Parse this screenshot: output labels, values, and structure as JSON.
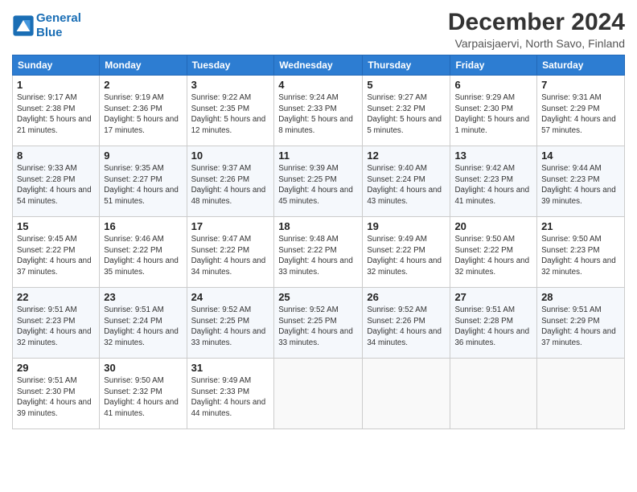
{
  "logo": {
    "line1": "General",
    "line2": "Blue"
  },
  "title": "December 2024",
  "subtitle": "Varpaisjaervi, North Savo, Finland",
  "days_of_week": [
    "Sunday",
    "Monday",
    "Tuesday",
    "Wednesday",
    "Thursday",
    "Friday",
    "Saturday"
  ],
  "weeks": [
    [
      {
        "day": "1",
        "sunrise": "9:17 AM",
        "sunset": "2:38 PM",
        "daylight": "5 hours and 21 minutes."
      },
      {
        "day": "2",
        "sunrise": "9:19 AM",
        "sunset": "2:36 PM",
        "daylight": "5 hours and 17 minutes."
      },
      {
        "day": "3",
        "sunrise": "9:22 AM",
        "sunset": "2:35 PM",
        "daylight": "5 hours and 12 minutes."
      },
      {
        "day": "4",
        "sunrise": "9:24 AM",
        "sunset": "2:33 PM",
        "daylight": "5 hours and 8 minutes."
      },
      {
        "day": "5",
        "sunrise": "9:27 AM",
        "sunset": "2:32 PM",
        "daylight": "5 hours and 5 minutes."
      },
      {
        "day": "6",
        "sunrise": "9:29 AM",
        "sunset": "2:30 PM",
        "daylight": "5 hours and 1 minute."
      },
      {
        "day": "7",
        "sunrise": "9:31 AM",
        "sunset": "2:29 PM",
        "daylight": "4 hours and 57 minutes."
      }
    ],
    [
      {
        "day": "8",
        "sunrise": "9:33 AM",
        "sunset": "2:28 PM",
        "daylight": "4 hours and 54 minutes."
      },
      {
        "day": "9",
        "sunrise": "9:35 AM",
        "sunset": "2:27 PM",
        "daylight": "4 hours and 51 minutes."
      },
      {
        "day": "10",
        "sunrise": "9:37 AM",
        "sunset": "2:26 PM",
        "daylight": "4 hours and 48 minutes."
      },
      {
        "day": "11",
        "sunrise": "9:39 AM",
        "sunset": "2:25 PM",
        "daylight": "4 hours and 45 minutes."
      },
      {
        "day": "12",
        "sunrise": "9:40 AM",
        "sunset": "2:24 PM",
        "daylight": "4 hours and 43 minutes."
      },
      {
        "day": "13",
        "sunrise": "9:42 AM",
        "sunset": "2:23 PM",
        "daylight": "4 hours and 41 minutes."
      },
      {
        "day": "14",
        "sunrise": "9:44 AM",
        "sunset": "2:23 PM",
        "daylight": "4 hours and 39 minutes."
      }
    ],
    [
      {
        "day": "15",
        "sunrise": "9:45 AM",
        "sunset": "2:22 PM",
        "daylight": "4 hours and 37 minutes."
      },
      {
        "day": "16",
        "sunrise": "9:46 AM",
        "sunset": "2:22 PM",
        "daylight": "4 hours and 35 minutes."
      },
      {
        "day": "17",
        "sunrise": "9:47 AM",
        "sunset": "2:22 PM",
        "daylight": "4 hours and 34 minutes."
      },
      {
        "day": "18",
        "sunrise": "9:48 AM",
        "sunset": "2:22 PM",
        "daylight": "4 hours and 33 minutes."
      },
      {
        "day": "19",
        "sunrise": "9:49 AM",
        "sunset": "2:22 PM",
        "daylight": "4 hours and 32 minutes."
      },
      {
        "day": "20",
        "sunrise": "9:50 AM",
        "sunset": "2:22 PM",
        "daylight": "4 hours and 32 minutes."
      },
      {
        "day": "21",
        "sunrise": "9:50 AM",
        "sunset": "2:23 PM",
        "daylight": "4 hours and 32 minutes."
      }
    ],
    [
      {
        "day": "22",
        "sunrise": "9:51 AM",
        "sunset": "2:23 PM",
        "daylight": "4 hours and 32 minutes."
      },
      {
        "day": "23",
        "sunrise": "9:51 AM",
        "sunset": "2:24 PM",
        "daylight": "4 hours and 32 minutes."
      },
      {
        "day": "24",
        "sunrise": "9:52 AM",
        "sunset": "2:25 PM",
        "daylight": "4 hours and 33 minutes."
      },
      {
        "day": "25",
        "sunrise": "9:52 AM",
        "sunset": "2:25 PM",
        "daylight": "4 hours and 33 minutes."
      },
      {
        "day": "26",
        "sunrise": "9:52 AM",
        "sunset": "2:26 PM",
        "daylight": "4 hours and 34 minutes."
      },
      {
        "day": "27",
        "sunrise": "9:51 AM",
        "sunset": "2:28 PM",
        "daylight": "4 hours and 36 minutes."
      },
      {
        "day": "28",
        "sunrise": "9:51 AM",
        "sunset": "2:29 PM",
        "daylight": "4 hours and 37 minutes."
      }
    ],
    [
      {
        "day": "29",
        "sunrise": "9:51 AM",
        "sunset": "2:30 PM",
        "daylight": "4 hours and 39 minutes."
      },
      {
        "day": "30",
        "sunrise": "9:50 AM",
        "sunset": "2:32 PM",
        "daylight": "4 hours and 41 minutes."
      },
      {
        "day": "31",
        "sunrise": "9:49 AM",
        "sunset": "2:33 PM",
        "daylight": "4 hours and 44 minutes."
      },
      null,
      null,
      null,
      null
    ]
  ],
  "labels": {
    "sunrise": "Sunrise:",
    "sunset": "Sunset:",
    "daylight": "Daylight:"
  }
}
